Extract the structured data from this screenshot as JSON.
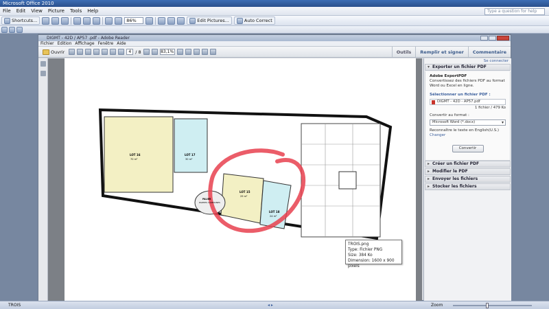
{
  "office": {
    "title": "Microsoft Office 2010",
    "menu": [
      "File",
      "Edit",
      "View",
      "Picture",
      "Tools",
      "Help"
    ],
    "help_placeholder": "Type a question for help",
    "toolbar": {
      "shortcuts": "Shortcuts...",
      "zoom": "86%",
      "edit_pictures": "Edit Pictures...",
      "auto_correct": "Auto Correct"
    }
  },
  "reader": {
    "title": "DIGMT - 42D / AP57 .pdf - Adobe Reader",
    "menu": [
      "Fichier",
      "Edition",
      "Affichage",
      "Fenêtre",
      "Aide"
    ],
    "toolbar": {
      "open": "Ouvrir",
      "page_current": "4",
      "page_total": "/ 8",
      "zoom": "83,1%"
    },
    "tabs": [
      "Outils",
      "Remplir et signer",
      "Commentaire"
    ]
  },
  "panel": {
    "sign_in": "Se connecter",
    "export_header": "Exporter un fichier PDF",
    "export_title": "Adobe ExportPDF",
    "export_desc": "Convertissez des fichiers PDF au format Word ou Excel en ligne.",
    "select_label": "Sélectionner un fichier PDF :",
    "file_name": "DIGMT - 42D - AP57.pdf",
    "file_size": "1 fichier / 479 Ko",
    "convert_label": "Convertir au format :",
    "format": "Microsoft Word (*.docx)",
    "recognize": "Reconnaître le texte en English(U.S.)",
    "change": "Changer",
    "convert_button": "Convertir",
    "sections": [
      "Créer un fichier PDF",
      "Modifier le PDF",
      "Envoyer les fichiers",
      "Stocker les fichiers"
    ]
  },
  "tooltip": {
    "name": "TROIS.png",
    "type": "Type: Fichier PNG",
    "size": "Size: 384 Ko",
    "dimension": "Dimension: 1600 x 900 pixels"
  },
  "plan_labels": {
    "lot16": "LOT 16",
    "lot16_area": "70 m²",
    "lot17": "LOT 17",
    "lot17_area": "30 m²",
    "lot15": "LOT 15",
    "lot15_area": "29 m²",
    "lot18": "LOT 18",
    "lot18_area": "24 m²",
    "palier": "PALIER",
    "parties_communes": "PARTIES COMMUNES"
  },
  "status": {
    "left": "TROIS",
    "zoom": "Zoom"
  },
  "colors": {
    "lot_yellow": "#f3f0c4",
    "lot_blue": "#cfeef2",
    "red_circle": "#e8414f"
  }
}
